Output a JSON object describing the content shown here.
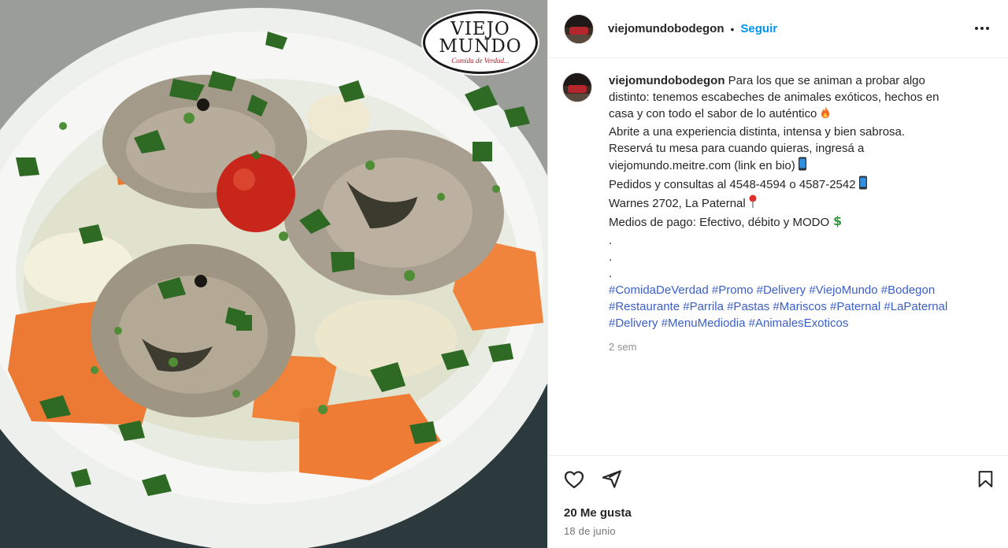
{
  "photo": {
    "alt": "Plato de escabeche con zanahorias, cebolla, perejil y tomate cherry",
    "logo": {
      "line1": "VIEJO",
      "line2": "MUNDO",
      "tagline": "Comida de Verdad..."
    }
  },
  "header": {
    "username": "viejomundobodegon",
    "separator": "•",
    "follow_label": "Seguir",
    "more_icon": "more-horizontal-icon"
  },
  "caption": {
    "username": "viejomundobodegon",
    "lines": [
      "Para los que se animan a probar algo",
      "distinto: tenemos escabeches de animales exóticos, hechos en",
      "casa y con todo el sabor de lo auténtico",
      "Abrite a una experiencia distinta, intensa y bien sabrosa.",
      "Reservá tu mesa para cuando quieras, ingresá a",
      "viejomundo.meitre.com (link en bio)",
      "Pedidos y consultas al 4548-4594 o 4587-2542",
      "Warnes 2702, La Paternal",
      "Medios de pago: Efectivo, débito y MODO",
      ".",
      ".",
      "."
    ],
    "emojis": [
      "fire-emoji",
      "phone-emoji",
      "phone-emoji",
      "pin-emoji",
      "money-emoji"
    ],
    "hashtags": [
      [
        "#ComidaDeVerdad",
        "#Promo",
        "#Delivery",
        "#ViejoMundo",
        "#Bodegon"
      ],
      [
        "#Restaurante",
        "#Parrila",
        "#Pastas",
        "#Mariscos",
        "#Paternal",
        "#LaPaternal"
      ],
      [
        "#Delivery",
        "#MenuMediodia",
        "#AnimalesExoticos"
      ]
    ],
    "time": "2 sem"
  },
  "actions": {
    "like_icon": "heart-icon",
    "share_icon": "send-icon",
    "save_icon": "bookmark-icon"
  },
  "likes": "20 Me gusta",
  "date": "18 de junio"
}
